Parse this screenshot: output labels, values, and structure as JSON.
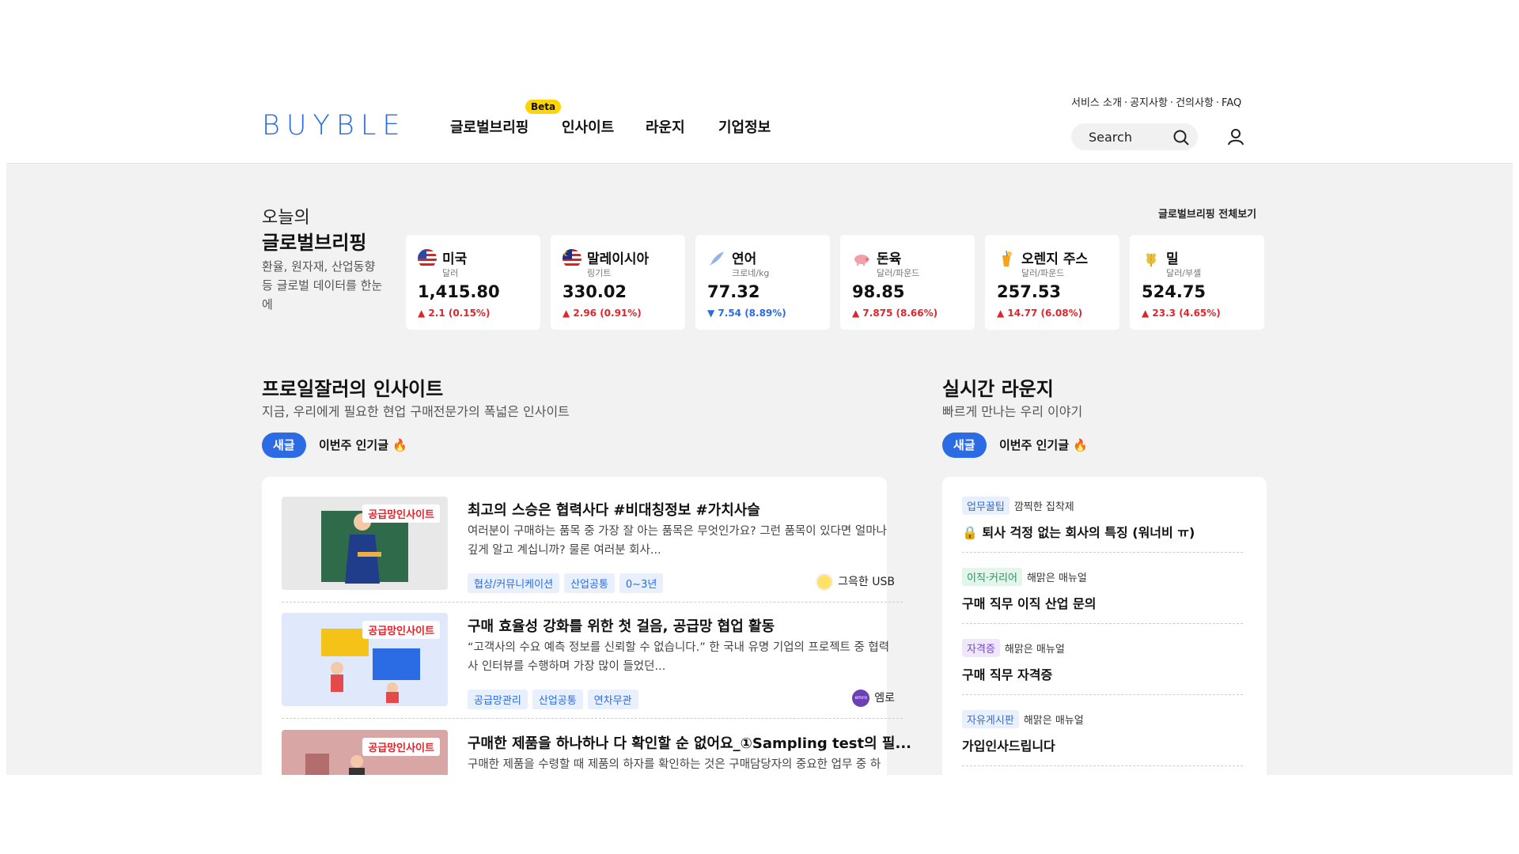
{
  "header": {
    "logo": "BUYBLE",
    "nav": [
      {
        "label": "글로벌브리핑"
      },
      {
        "label": "인사이트"
      },
      {
        "label": "라운지"
      },
      {
        "label": "기업정보"
      }
    ],
    "beta_badge": "Beta",
    "util_links": [
      "서비스 소개",
      "공지사항",
      "건의사항",
      "FAQ"
    ],
    "util_sep": "·",
    "search_placeholder": "Search",
    "accent_color": "#2b6be4"
  },
  "briefing": {
    "hello": "오늘의",
    "title": "글로벌브리핑",
    "desc": "환율, 원자재, 산업동향 등 글로벌 데이터를 한눈에",
    "more": "글로벌브리핑 전체보기",
    "cards": [
      {
        "name": "미국",
        "unit": "달러",
        "price": "1,415.80",
        "change": "2.1 (0.15%)",
        "dir": "up",
        "icon": "us-flag-icon"
      },
      {
        "name": "말레이시아",
        "unit": "링기트",
        "price": "330.02",
        "change": "2.96 (0.91%)",
        "dir": "up",
        "icon": "malaysia-flag-icon"
      },
      {
        "name": "연어",
        "unit": "크로네/kg",
        "price": "77.32",
        "change": "7.54 (8.89%)",
        "dir": "down",
        "icon": "salmon-icon"
      },
      {
        "name": "돈육",
        "unit": "달러/파운드",
        "price": "98.85",
        "change": "7.875 (8.66%)",
        "dir": "up",
        "icon": "pig-icon"
      },
      {
        "name": "오렌지 주스",
        "unit": "달러/파운드",
        "price": "257.53",
        "change": "14.77 (6.08%)",
        "dir": "up",
        "icon": "orange-juice-icon"
      },
      {
        "name": "밀",
        "unit": "달러/부셸",
        "price": "524.75",
        "change": "23.3 (4.65%)",
        "dir": "up",
        "icon": "wheat-icon"
      }
    ]
  },
  "insights": {
    "title": "프로일잘러의 인사이트",
    "sub": "지금, 우리에게 필요한 현업 구매전문가의 폭넓은 인사이트",
    "tab_new": "새글",
    "tab_hot": "이번주 인기글",
    "posts": [
      {
        "badge": "공급망인사이트",
        "title": "최고의 스승은 협력사다 #비대칭정보 #가치사슬",
        "excerpt": "여러분이 구매하는 품목 중 가장 잘 아는 품목은 무엇인가요? 그런 품목이 있다면 얼마나 깊게 알고 계십니까? 물론 여러분 회사...",
        "tags": [
          "협상/커뮤니케이션",
          "산업공통",
          "0~3년"
        ],
        "author": "그윽한 USB"
      },
      {
        "badge": "공급망인사이트",
        "title": "구매 효율성 강화를 위한 첫 걸음, 공급망 협업 활동",
        "excerpt": "“고객사의 수요 예측 정보를 신뢰할 수 없습니다.” 한 국내 유명 기업의 프로젝트 중 협력사 인터뷰를 수행하며 가장 많이 들었던...",
        "tags": [
          "공급망관리",
          "산업공통",
          "연차무관"
        ],
        "author": "엠로",
        "avatar_text": "emro"
      },
      {
        "badge": "공급망인사이트",
        "title": "구매한 제품을 하나하나 다 확인할 순 없어요_①Sampling test의 필...",
        "excerpt": "구매한 제품을 수령할 때 제품의 하자를 확인하는 것은 구매담당자의 중요한 업무 중 하",
        "tags": [],
        "author": ""
      }
    ]
  },
  "lounge": {
    "title": "실시간 라운지",
    "sub": "빠르게 만나는 우리 이야기",
    "tab_new": "새글",
    "tab_hot": "이번주 인기글",
    "items": [
      {
        "category": "업무꿀팁",
        "cat_color": "#2b6be4",
        "cat_bg": "#e8f0fd",
        "author": "깜찍한 집착제",
        "title": "🔒 퇴사 걱정 없는 회사의 특징 (워너비 ㅠ)"
      },
      {
        "category": "이직·커리어",
        "cat_color": "#1a9a5a",
        "cat_bg": "#e4f6ec",
        "author": "해맑은 매뉴얼",
        "title": "구매 직무 이직 산업 문의"
      },
      {
        "category": "자격증",
        "cat_color": "#7a3fd6",
        "cat_bg": "#efe7fb",
        "author": "해맑은 매뉴얼",
        "title": "구매 직무 자격증"
      },
      {
        "category": "자유게시판",
        "cat_color": "#2b6be4",
        "cat_bg": "#e8f0fd",
        "author": "해맑은 매뉴얼",
        "title": "가입인사드립니다"
      }
    ]
  }
}
